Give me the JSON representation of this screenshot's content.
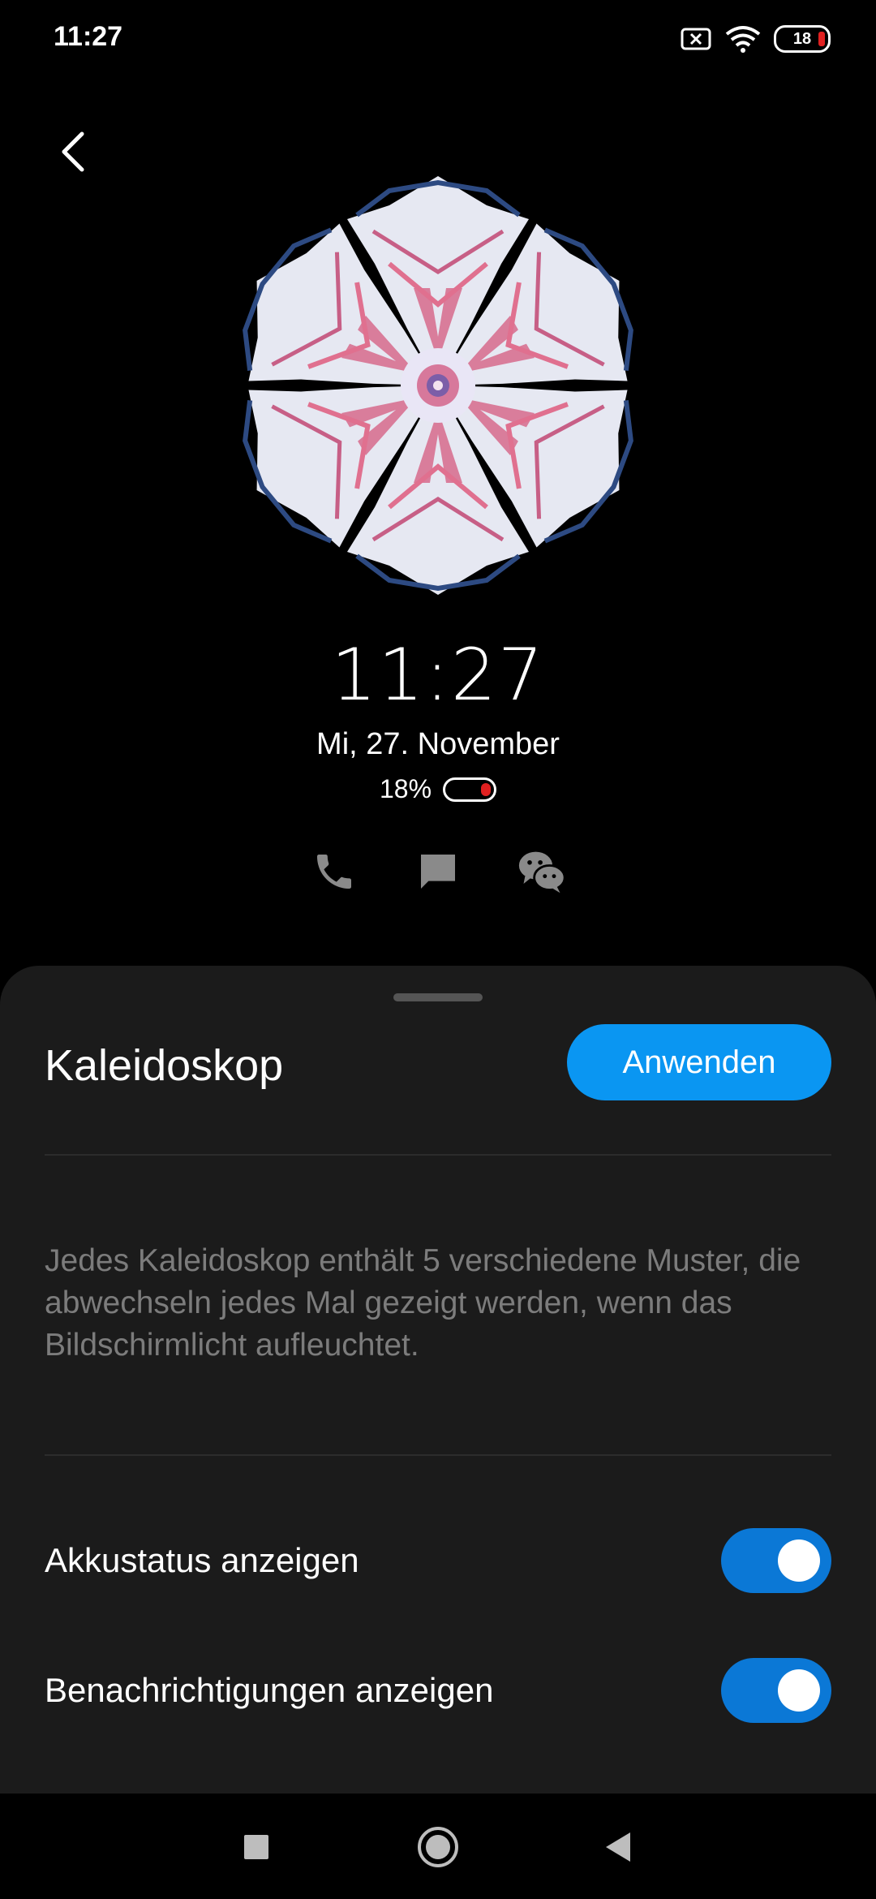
{
  "status_bar": {
    "time": "11:27",
    "battery_level": "18"
  },
  "preview": {
    "time": "11:27",
    "date": "Mi, 27. November",
    "battery_percent": "18%",
    "notification_icons": [
      "phone-icon",
      "message-icon",
      "wechat-icon"
    ]
  },
  "sheet": {
    "title": "Kaleidoskop",
    "apply_label": "Anwenden",
    "description": "Jedes Kaleidoskop enthält 5 verschiedene Muster, die abwechseln jedes Mal gezeigt werden, wenn das Bildschirmlicht aufleuchtet.",
    "settings": [
      {
        "label": "Akkustatus anzeigen",
        "enabled": true
      },
      {
        "label": "Benachrichtigungen anzeigen",
        "enabled": true
      }
    ]
  },
  "colors": {
    "accent": "#0a96f2",
    "toggle_on": "#0b78d6",
    "sheet_background": "#1b1b1b",
    "battery_low": "#e02020"
  },
  "nav_icons": [
    "recents-square-icon",
    "home-circle-icon",
    "back-triangle-icon"
  ]
}
